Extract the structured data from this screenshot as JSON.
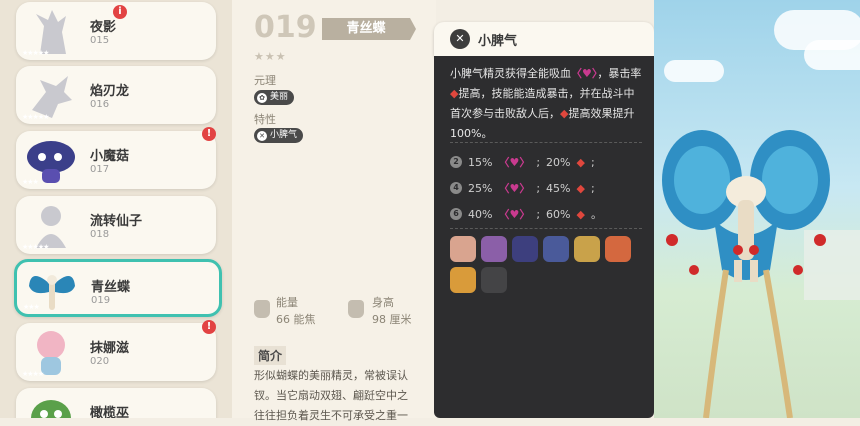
{
  "list": {
    "items": [
      {
        "name": "夜影",
        "num": "015",
        "stars": "★★★★★",
        "badge": "i"
      },
      {
        "name": "焰刃龙",
        "num": "016",
        "stars": "★★★★★",
        "badge": ""
      },
      {
        "name": "小魔菇",
        "num": "017",
        "stars": "★★★",
        "badge": "!"
      },
      {
        "name": "流转仙子",
        "num": "018",
        "stars": "★★★★★",
        "badge": ""
      },
      {
        "name": "青丝蝶",
        "num": "019",
        "stars": "★★★",
        "badge": ""
      },
      {
        "name": "抹娜滋",
        "num": "020",
        "stars": "★★★★",
        "badge": "!"
      },
      {
        "name": "橄榄巫",
        "num": "",
        "stars": "",
        "badge": ""
      }
    ]
  },
  "detail": {
    "number": "019",
    "name": "青丝蝶",
    "stars": "★★★",
    "element_label": "元理",
    "element_value": "美丽",
    "trait_label": "特性",
    "trait_value": "小脾气",
    "energy_label": "能量",
    "energy_value": "66 能焦",
    "height_label": "身高",
    "height_value": "98 厘米",
    "intro_title": "简介",
    "intro_line1": "形似蝴蝶的美丽精灵，常被误认",
    "intro_line2": "钗。当它扇动双翅、翩跹空中之",
    "intro_line3": "往往担负着灵生不可承受之重一"
  },
  "tooltip": {
    "title": "小脾气",
    "desc_a": "小脾气精灵获得全能吸血",
    "desc_b": "，暴击率",
    "desc_c": "提高，技能能造成暴击，并在战斗中首次参与击败敌人后，",
    "desc_d": "提高效果提升100%。",
    "levels": [
      {
        "n": "2",
        "a": "15%",
        "b": "20%"
      },
      {
        "n": "4",
        "a": "25%",
        "b": "45%"
      },
      {
        "n": "6",
        "a": "40%",
        "b": "60%"
      }
    ]
  },
  "colors": {
    "accent": "#3fc1b0",
    "badge": "#e24343",
    "tooltip_bg": "#2d2d2f"
  }
}
